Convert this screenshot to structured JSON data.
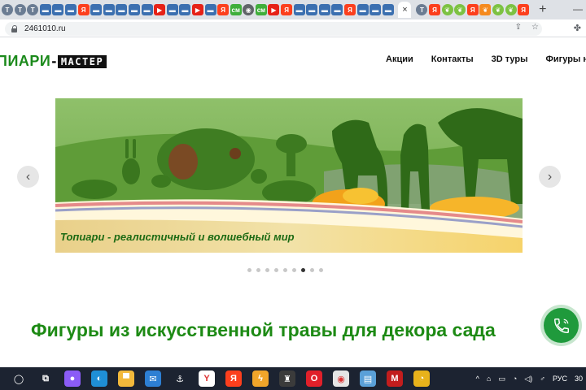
{
  "browser": {
    "tabs": [
      {
        "icon": "tab-favicon-circle",
        "glyph": "T",
        "style": "t-grey"
      },
      {
        "icon": "tab-favicon-circle",
        "glyph": "T",
        "style": "t-grey"
      },
      {
        "icon": "tab-favicon-circle",
        "glyph": "T",
        "style": "t-grey"
      },
      {
        "icon": "tab-favicon-doc",
        "glyph": "▬",
        "style": "t-blue"
      },
      {
        "icon": "tab-favicon-doc",
        "glyph": "▬",
        "style": "t-blue"
      },
      {
        "icon": "tab-favicon-doc",
        "glyph": "▬",
        "style": "t-blue"
      },
      {
        "icon": "tab-favicon-yandex",
        "glyph": "Я",
        "style": "t-ya"
      },
      {
        "icon": "tab-favicon-doc",
        "glyph": "▬",
        "style": "t-blue"
      },
      {
        "icon": "tab-favicon-doc",
        "glyph": "▬",
        "style": "t-blue"
      },
      {
        "icon": "tab-favicon-doc",
        "glyph": "▬",
        "style": "t-blue"
      },
      {
        "icon": "tab-favicon-doc",
        "glyph": "▬",
        "style": "t-blue"
      },
      {
        "icon": "tab-favicon-doc",
        "glyph": "▬",
        "style": "t-blue"
      },
      {
        "icon": "tab-favicon-youtube",
        "glyph": "▶",
        "style": "t-yt"
      },
      {
        "icon": "tab-favicon-doc",
        "glyph": "▬",
        "style": "t-blue"
      },
      {
        "icon": "tab-favicon-doc",
        "glyph": "▬",
        "style": "t-blue"
      },
      {
        "icon": "tab-favicon-youtube",
        "glyph": "▶",
        "style": "t-yt"
      },
      {
        "icon": "tab-favicon-doc",
        "glyph": "▬",
        "style": "t-blue"
      },
      {
        "icon": "tab-favicon-yandex",
        "glyph": "Я",
        "style": "t-ya"
      },
      {
        "icon": "tab-favicon-sm",
        "glyph": "см",
        "style": "t-green"
      },
      {
        "icon": "tab-favicon-globe",
        "glyph": "◉",
        "style": "t-globe"
      },
      {
        "icon": "tab-favicon-sm",
        "glyph": "см",
        "style": "t-green"
      },
      {
        "icon": "tab-favicon-youtube",
        "glyph": "▶",
        "style": "t-yt"
      },
      {
        "icon": "tab-favicon-yandex",
        "glyph": "Я",
        "style": "t-ya"
      },
      {
        "icon": "tab-favicon-doc",
        "glyph": "▬",
        "style": "t-blue"
      },
      {
        "icon": "tab-favicon-doc",
        "glyph": "▬",
        "style": "t-blue"
      },
      {
        "icon": "tab-favicon-doc",
        "glyph": "▬",
        "style": "t-blue"
      },
      {
        "icon": "tab-favicon-doc",
        "glyph": "▬",
        "style": "t-blue"
      },
      {
        "icon": "tab-favicon-yandex",
        "glyph": "Я",
        "style": "t-ya"
      },
      {
        "icon": "tab-favicon-doc",
        "glyph": "▬",
        "style": "t-blue"
      },
      {
        "icon": "tab-favicon-doc",
        "glyph": "▬",
        "style": "t-blue"
      },
      {
        "icon": "tab-favicon-doc",
        "glyph": "▬",
        "style": "t-blue"
      }
    ],
    "active_tab_close": "×",
    "tabs_after": [
      {
        "icon": "tab-favicon-circle",
        "glyph": "T",
        "style": "t-grey"
      },
      {
        "icon": "tab-favicon-yandex",
        "glyph": "Я",
        "style": "t-ya"
      },
      {
        "icon": "tab-favicon-leaf",
        "glyph": "❦",
        "style": "t-lime"
      },
      {
        "icon": "tab-favicon-leaf",
        "glyph": "❦",
        "style": "t-lime"
      },
      {
        "icon": "tab-favicon-yandex",
        "glyph": "Я",
        "style": "t-ya"
      },
      {
        "icon": "tab-favicon-leaf",
        "glyph": "❦",
        "style": "t-orange"
      },
      {
        "icon": "tab-favicon-leaf",
        "glyph": "❦",
        "style": "t-lime"
      },
      {
        "icon": "tab-favicon-leaf",
        "glyph": "❦",
        "style": "t-lime"
      },
      {
        "icon": "tab-favicon-yandex",
        "glyph": "Я",
        "style": "t-ya"
      }
    ],
    "new_tab": "+",
    "minimize": "—",
    "url": "2461010.ru"
  },
  "site": {
    "logo_part1": "ПИАРИ",
    "logo_dash": "-",
    "logo_part2": "МАСТЕР",
    "nav": [
      "Акции",
      "Контакты",
      "3D туры",
      "Фигуры на"
    ],
    "slide_caption": "Топиари -  реалистичный и волшебный мир",
    "arrow_prev": "‹",
    "arrow_next": "›",
    "slider_dots": 9,
    "slider_active_dot": 6,
    "headline": "Фигуры из искусственной травы для декора сада",
    "accent_color": "#1d8a14",
    "call_button_color": "#1f9a3c"
  },
  "taskbar": {
    "apps": [
      {
        "icon": "start-icon",
        "glyph": "◯",
        "bg": "transparent"
      },
      {
        "icon": "task-view-icon",
        "glyph": "⧉",
        "bg": "transparent"
      },
      {
        "icon": "alice-icon",
        "glyph": "●",
        "bg": "#8b5cf6"
      },
      {
        "icon": "edge-icon",
        "glyph": "◐",
        "bg": "#1f8fd6"
      },
      {
        "icon": "file-explorer-icon",
        "glyph": "▀",
        "bg": "#f2b93b"
      },
      {
        "icon": "mail-icon",
        "glyph": "✉",
        "bg": "#2d7fd3"
      },
      {
        "icon": "anchor-icon",
        "glyph": "⚓",
        "bg": "transparent"
      },
      {
        "icon": "yandex-browser-icon",
        "glyph": "Y",
        "bg": "#ffffff"
      },
      {
        "icon": "yandex-icon",
        "glyph": "Я",
        "bg": "#fc3f1d"
      },
      {
        "icon": "lightning-icon",
        "glyph": "ϟ",
        "bg": "#f0a52a"
      },
      {
        "icon": "game-icon",
        "glyph": "♜",
        "bg": "#3b3b3b"
      },
      {
        "icon": "opera-icon",
        "glyph": "O",
        "bg": "#e0202a"
      },
      {
        "icon": "chrome-icon",
        "glyph": "◉",
        "bg": "#e5e5e5"
      },
      {
        "icon": "notepad-icon",
        "glyph": "▤",
        "bg": "#5aa0d8"
      },
      {
        "icon": "mcafee-icon",
        "glyph": "M",
        "bg": "#c21d1d"
      },
      {
        "icon": "power-icon",
        "glyph": "◔",
        "bg": "#e8b21b"
      }
    ],
    "tray": [
      "^",
      "⌂",
      "▭",
      "◔",
      "◁)",
      "♂",
      "РУС",
      "30"
    ]
  }
}
